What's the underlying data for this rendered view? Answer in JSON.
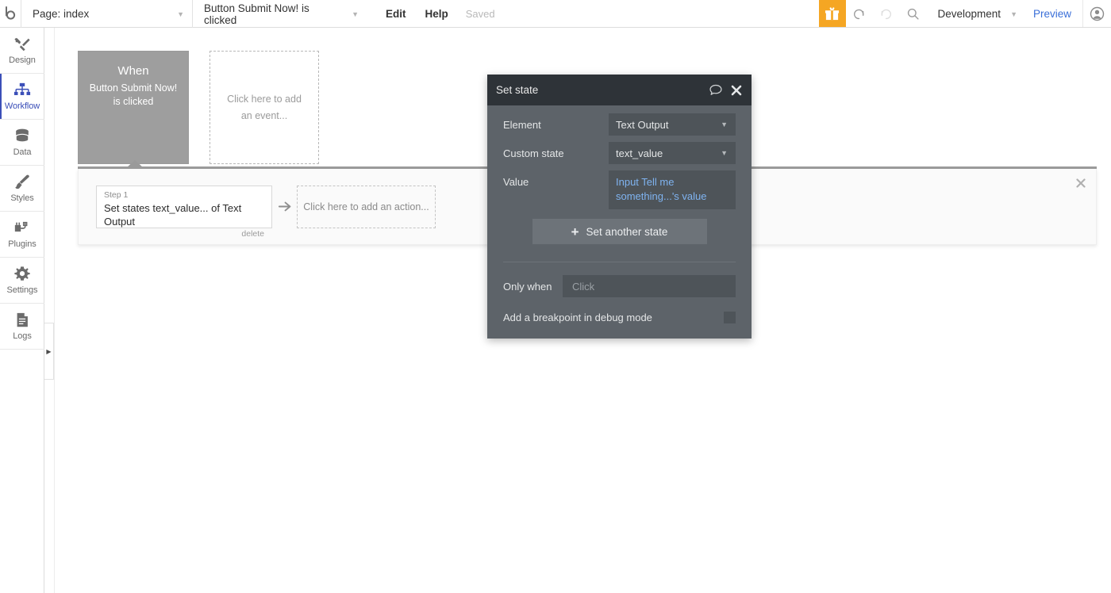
{
  "topbar": {
    "logo": "bubble-logo-icon",
    "page_selector": {
      "label": "Page: index",
      "caret": "chevron-down-icon"
    },
    "event_selector": {
      "label": "Button Submit Now! is clicked",
      "caret": "chevron-down-icon"
    },
    "edit_label": "Edit",
    "help_label": "Help",
    "saved_label": "Saved",
    "gift_icon": "gift-icon",
    "undo_icon": "undo-icon",
    "redo_icon": "redo-icon",
    "search_icon": "search-icon",
    "version_label": "Development",
    "version_caret": "chevron-down-icon",
    "preview_label": "Preview",
    "avatar_icon": "user-avatar-icon",
    "accent_gift_bg": "#f5a623",
    "preview_color": "#3a6fd8"
  },
  "sidebar": {
    "items": [
      {
        "label": "Design",
        "icon": "design-tools-icon",
        "active": false
      },
      {
        "label": "Workflow",
        "icon": "workflow-hierarchy-icon",
        "active": true
      },
      {
        "label": "Data",
        "icon": "database-icon",
        "active": false
      },
      {
        "label": "Styles",
        "icon": "paintbrush-icon",
        "active": false
      },
      {
        "label": "Plugins",
        "icon": "plugin-icon",
        "active": false
      },
      {
        "label": "Settings",
        "icon": "gear-icon",
        "active": false
      },
      {
        "label": "Logs",
        "icon": "document-logs-icon",
        "active": false
      }
    ],
    "active_color": "#3b4fb8",
    "collapse_icon": "chevron-right-icon"
  },
  "canvas": {
    "when_box": {
      "title": "When",
      "subtitle": "Button Submit Now! is clicked",
      "bg": "#9e9e9e"
    },
    "add_event_box": {
      "label": "Click here to add an event..."
    },
    "action_panel": {
      "step": {
        "label": "Step 1",
        "title": "Set states text_value... of Text Output",
        "delete_label": "delete"
      },
      "arrow_icon": "arrow-right-icon",
      "add_action_label": "Click here to add an action...",
      "close_icon": "close-icon"
    }
  },
  "modal": {
    "title": "Set state",
    "comment_icon": "comment-bubble-icon",
    "close_icon": "close-icon",
    "fields": [
      {
        "label": "Element",
        "value": "Text Output",
        "caret": "chevron-down-icon"
      },
      {
        "label": "Custom state",
        "value": "text_value",
        "caret": "chevron-down-icon"
      }
    ],
    "value_row": {
      "label": "Value",
      "value": "Input Tell me something...'s value",
      "value_color": "#7fb3f0"
    },
    "set_another_button": {
      "label": "Set another state",
      "plus_icon": "plus-icon"
    },
    "only_when": {
      "label": "Only when",
      "placeholder": "Click",
      "value": ""
    },
    "breakpoint": {
      "label": "Add a breakpoint in debug mode",
      "checked": false
    }
  }
}
